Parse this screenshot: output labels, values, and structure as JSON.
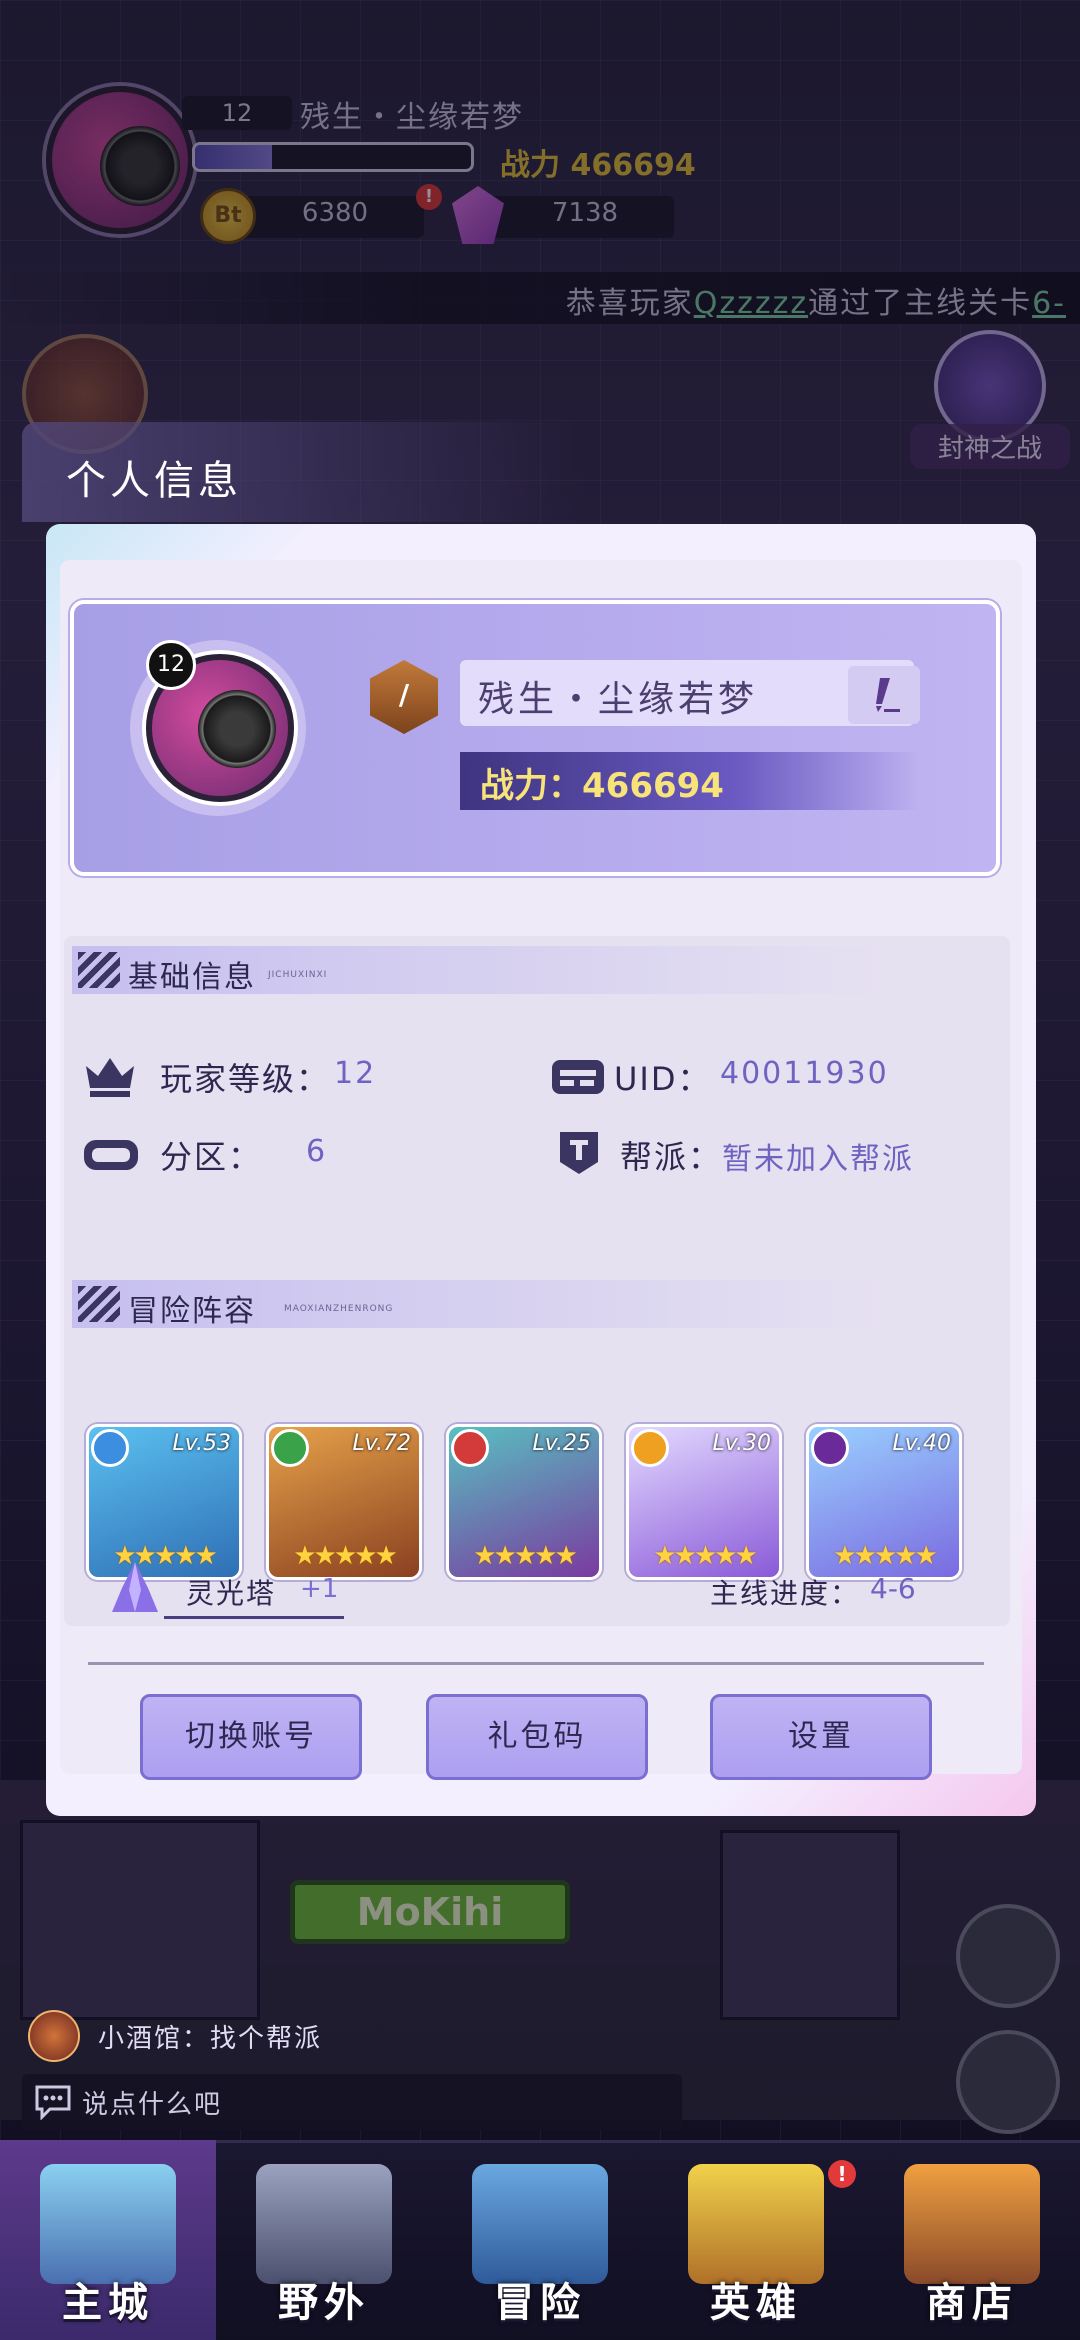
{
  "hud": {
    "level": "12",
    "player_name": "残生・尘缘若梦",
    "xp_progress": 0.28,
    "power_text": "战力 466694",
    "coins": "6380",
    "coin_label": "Bt",
    "alert": "!",
    "gems": "7138"
  },
  "ticker": {
    "prefix": "恭喜玩家",
    "player": "Qzzzzz",
    "suffix": "通过了主线关卡",
    "stage": "6-"
  },
  "side_event": {
    "label": "封神之战"
  },
  "page_title": "个人信息",
  "profile": {
    "avatar_level": "12",
    "rank_symbol": "/",
    "name": "残生・尘缘若梦",
    "power_text": "战力：466694"
  },
  "basic_info": {
    "title": "基础信息",
    "subtitle": "JICHUXINXI",
    "player_level_label": "玩家等级：",
    "player_level_value": "12",
    "uid_label": "UID：",
    "uid_value": "40011930",
    "server_label": "分区：",
    "server_value": "6",
    "guild_label": "帮派：",
    "guild_value": "暂未加入帮派"
  },
  "lineup": {
    "title": "冒险阵容",
    "subtitle": "MAOXIANZHENRONG",
    "heroes": [
      {
        "level": "Lv.53",
        "element": "water",
        "element_color": "#3b8ee0",
        "stars": "★★★★★",
        "palette": [
          "#5bc0f0",
          "#2f6fb5"
        ]
      },
      {
        "level": "Lv.72",
        "element": "nature",
        "element_color": "#3aa34a",
        "stars": "★★★★★",
        "palette": [
          "#e6a24a",
          "#8a4020"
        ]
      },
      {
        "level": "Lv.25",
        "element": "fire",
        "element_color": "#d33a3a",
        "stars": "★★★★★",
        "palette": [
          "#58c0c0",
          "#7a3aa0"
        ]
      },
      {
        "level": "Lv.30",
        "element": "light",
        "element_color": "#f0a020",
        "stars": "★★★★★",
        "palette": [
          "#e3d9ff",
          "#8a5ad8"
        ]
      },
      {
        "level": "Lv.40",
        "element": "void",
        "element_color": "#6a2a9a",
        "stars": "★★★★★",
        "palette": [
          "#9ad0ff",
          "#7a6ae0"
        ]
      }
    ],
    "tower_label": "灵光塔",
    "tower_bonus": "+1",
    "story_label": "主线进度：",
    "story_value": "4-6"
  },
  "buttons": {
    "switch_account": "切换账号",
    "gift_code": "礼包码",
    "settings": "设置"
  },
  "background": {
    "sign": "MoKihi"
  },
  "chat": {
    "last_message": "小酒馆：找个帮派",
    "placeholder": "说点什么吧"
  },
  "nav": {
    "items": [
      "主城",
      "野外",
      "冒险",
      "英雄",
      "商店"
    ],
    "hero_alert": "!"
  },
  "colors": {
    "accent": "#6f63c2",
    "power": "#f7e37a",
    "button": "#ad9ff0"
  }
}
